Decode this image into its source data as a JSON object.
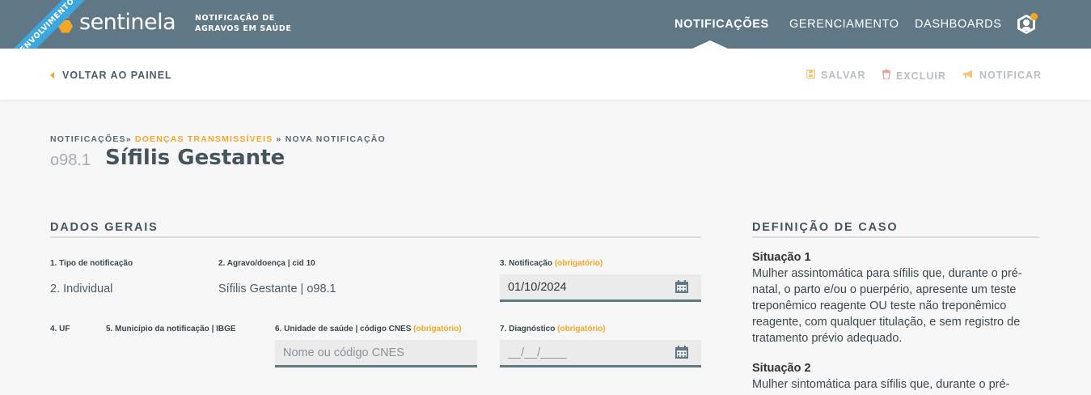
{
  "app": {
    "logo_text": "sentinela",
    "subtitle": "NOTIFICAÇÃO DE AGRAVOS EM SAÚDE",
    "env_ribbon": "DESENVOLVIMENTO"
  },
  "nav": {
    "items": [
      {
        "label": "NOTIFICAÇÕES",
        "active": true
      },
      {
        "label": "GERENCIAMENTO",
        "active": false
      },
      {
        "label": "DASHBOARDS",
        "active": false
      }
    ],
    "user_icon": "user-hexagon-icon"
  },
  "actions": {
    "back_label": "VOLTAR AO PAINEL",
    "save_label": "SALVAR",
    "delete_label": "EXCLUIR",
    "notify_label": "NOTIFICAR",
    "icons": {
      "save": "floppy-disk-icon",
      "delete": "trash-icon",
      "notify": "megaphone-icon"
    }
  },
  "page": {
    "breadcrumb": {
      "part1": "NOTIFICAÇÕES»",
      "part2": "DOENÇAS TRANSMISSÍVEIS",
      "part3": "» NOVA NOTIFICAÇÃO"
    },
    "code": "o98.1",
    "title": "Sífilis Gestante"
  },
  "dados_gerais": {
    "title": "DADOS GERAIS",
    "tipo_notificacao": {
      "label": "1. Tipo de notificação",
      "value": "2. Individual"
    },
    "agravo": {
      "label": "2. Agravo/doença | cid 10",
      "value": "Sífilis Gestante | o98.1"
    },
    "notificacao": {
      "label": "3. Notificação",
      "required": "(obrigatório)",
      "value": "01/10/2024"
    },
    "uf": {
      "label": "4. UF"
    },
    "municipio": {
      "label": "5. Município da notificação | IBGE"
    },
    "unidade": {
      "label": "6. Unidade de saúde | código CNES",
      "required": "(obrigatório)",
      "placeholder": "Nome ou código CNES"
    },
    "diagnostico": {
      "label": "7. Diagnóstico",
      "required": "(obrigatório)",
      "placeholder": "__/__/____"
    }
  },
  "definicao_caso": {
    "title": "DEFINIÇÃO DE CASO",
    "situacoes": [
      {
        "heading": "Situação 1",
        "text": "Mulher assintomática para sífilis que, durante o pré-natal, o parto e/ou o puerpério, apresente um teste treponêmico reagente OU teste não treponêmico reagente, com qualquer titulação, e sem registro de tratamento prévio adequado."
      },
      {
        "heading": "Situação 2",
        "text": "Mulher sintomática para sífilis que, durante o pré-"
      }
    ]
  },
  "colors": {
    "header": "#607886",
    "accent": "#f5a623",
    "ribbon": "#3ea7e0"
  }
}
